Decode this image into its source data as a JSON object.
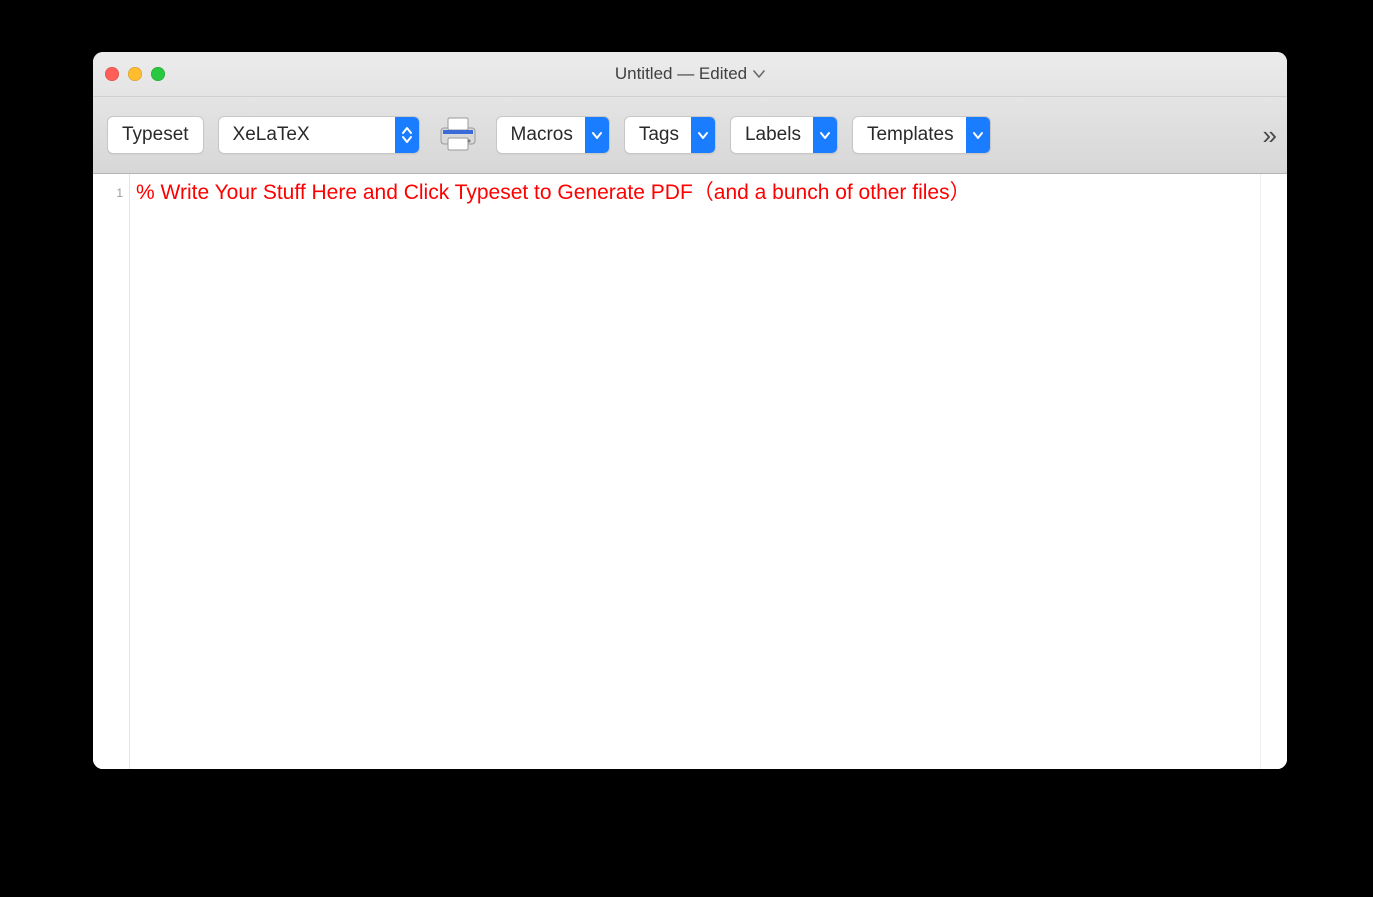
{
  "window": {
    "title": "Untitled — Edited"
  },
  "toolbar": {
    "typeset_label": "Typeset",
    "engine_selected": "XeLaTeX",
    "macros_label": "Macros",
    "tags_label": "Tags",
    "labels_label": "Labels",
    "templates_label": "Templates",
    "overflow_glyph": "»"
  },
  "editor": {
    "lines": [
      {
        "n": "1",
        "text": "% Write Your Stuff Here and Click Typeset to Generate PDF（and a bunch of other files）",
        "kind": "comment"
      }
    ]
  }
}
